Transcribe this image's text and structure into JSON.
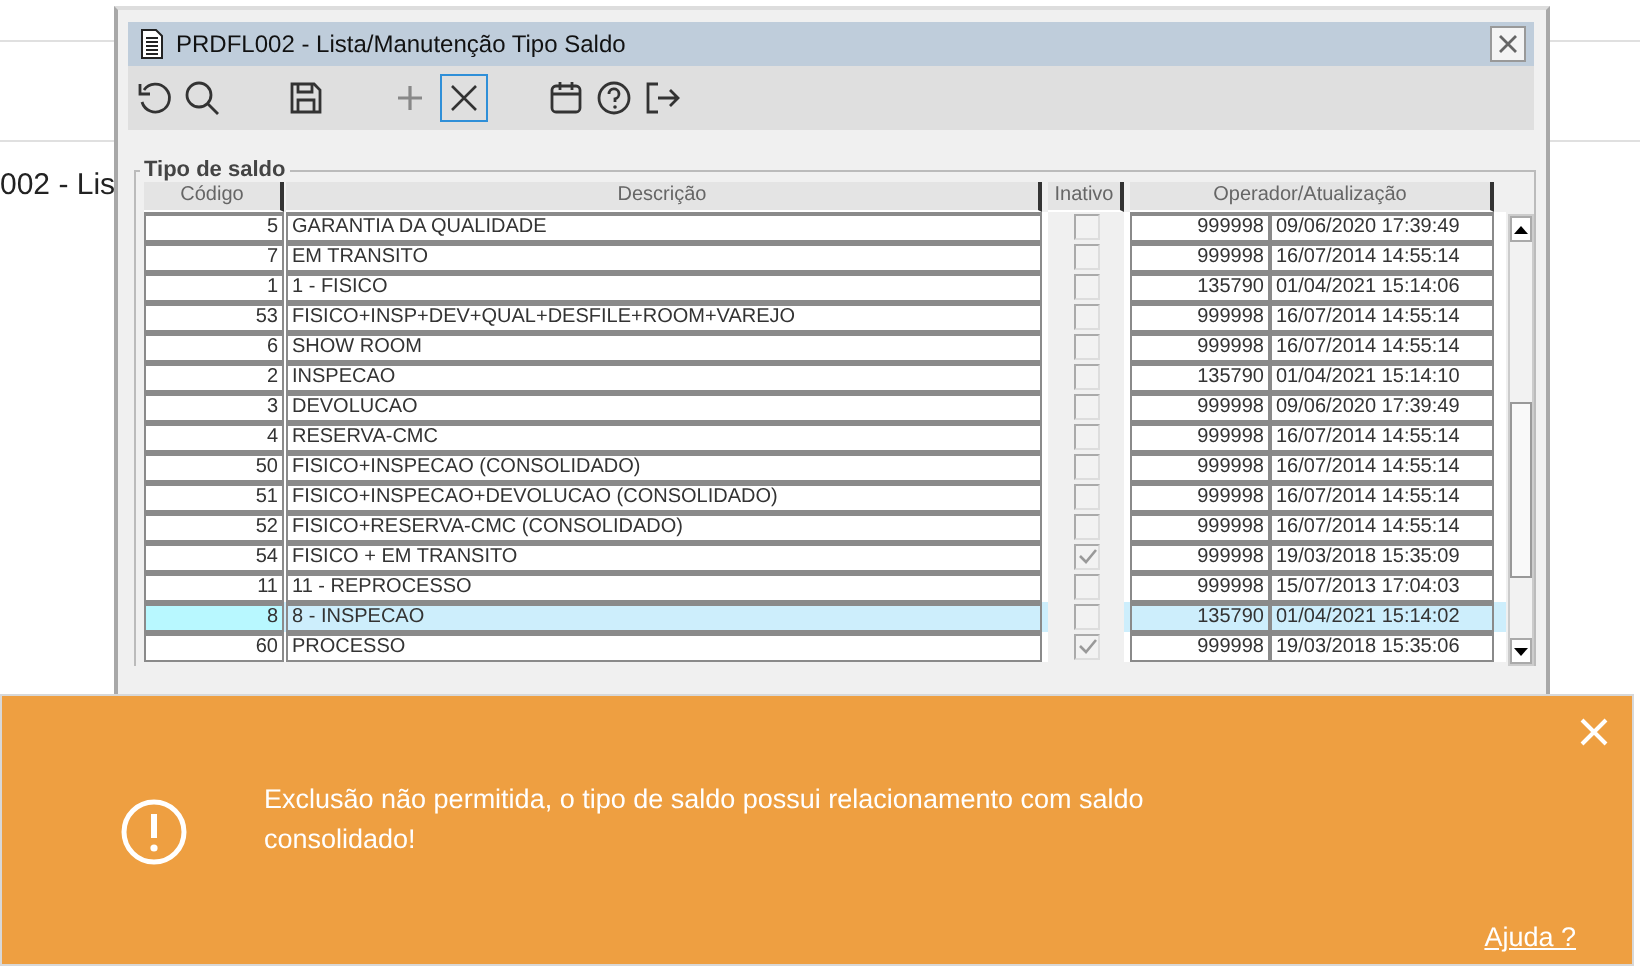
{
  "background": {
    "page_title": "002 - Lis"
  },
  "window": {
    "title": "PRDFL002 - Lista/Manutenção Tipo Saldo"
  },
  "group": {
    "title": "Tipo de saldo"
  },
  "table": {
    "columns": [
      "Código",
      "Descrição",
      "Inativo",
      "Operador/Atualização"
    ],
    "rows": [
      {
        "code": "5",
        "description": "GARANTIA DA QUALIDADE",
        "inactive": false,
        "operator": "999998",
        "updated": "09/06/2020 17:39:49",
        "selected": false
      },
      {
        "code": "7",
        "description": "EM TRANSITO",
        "inactive": false,
        "operator": "999998",
        "updated": "16/07/2014 14:55:14",
        "selected": false
      },
      {
        "code": "1",
        "description": "1 - FISICO",
        "inactive": false,
        "operator": "135790",
        "updated": "01/04/2021 15:14:06",
        "selected": false
      },
      {
        "code": "53",
        "description": "FISICO+INSP+DEV+QUAL+DESFILE+ROOM+VAREJO",
        "inactive": false,
        "operator": "999998",
        "updated": "16/07/2014 14:55:14",
        "selected": false
      },
      {
        "code": "6",
        "description": "SHOW ROOM",
        "inactive": false,
        "operator": "999998",
        "updated": "16/07/2014 14:55:14",
        "selected": false
      },
      {
        "code": "2",
        "description": "INSPECAO",
        "inactive": false,
        "operator": "135790",
        "updated": "01/04/2021 15:14:10",
        "selected": false
      },
      {
        "code": "3",
        "description": "DEVOLUCAO",
        "inactive": false,
        "operator": "999998",
        "updated": "09/06/2020 17:39:49",
        "selected": false
      },
      {
        "code": "4",
        "description": "RESERVA-CMC",
        "inactive": false,
        "operator": "999998",
        "updated": "16/07/2014 14:55:14",
        "selected": false
      },
      {
        "code": "50",
        "description": "FISICO+INSPECAO (CONSOLIDADO)",
        "inactive": false,
        "operator": "999998",
        "updated": "16/07/2014 14:55:14",
        "selected": false
      },
      {
        "code": "51",
        "description": "FISICO+INSPECAO+DEVOLUCAO (CONSOLIDADO)",
        "inactive": false,
        "operator": "999998",
        "updated": "16/07/2014 14:55:14",
        "selected": false
      },
      {
        "code": "52",
        "description": "FISICO+RESERVA-CMC (CONSOLIDADO)",
        "inactive": false,
        "operator": "999998",
        "updated": "16/07/2014 14:55:14",
        "selected": false
      },
      {
        "code": "54",
        "description": "FISICO + EM TRANSITO",
        "inactive": true,
        "operator": "999998",
        "updated": "19/03/2018 15:35:09",
        "selected": false
      },
      {
        "code": "11",
        "description": "11 - REPROCESSO",
        "inactive": false,
        "operator": "999998",
        "updated": "15/07/2013 17:04:03",
        "selected": false
      },
      {
        "code": "8",
        "description": "8 - INSPECAO",
        "inactive": false,
        "operator": "135790",
        "updated": "01/04/2021 15:14:02",
        "selected": true
      },
      {
        "code": "60",
        "description": "PROCESSO",
        "inactive": true,
        "operator": "999998",
        "updated": "19/03/2018 15:35:06",
        "selected": false
      }
    ]
  },
  "toast": {
    "message": "Exclusão não permitida, o tipo de saldo possui relacionamento com saldo consolidado!",
    "link": "Ajuda ?"
  }
}
